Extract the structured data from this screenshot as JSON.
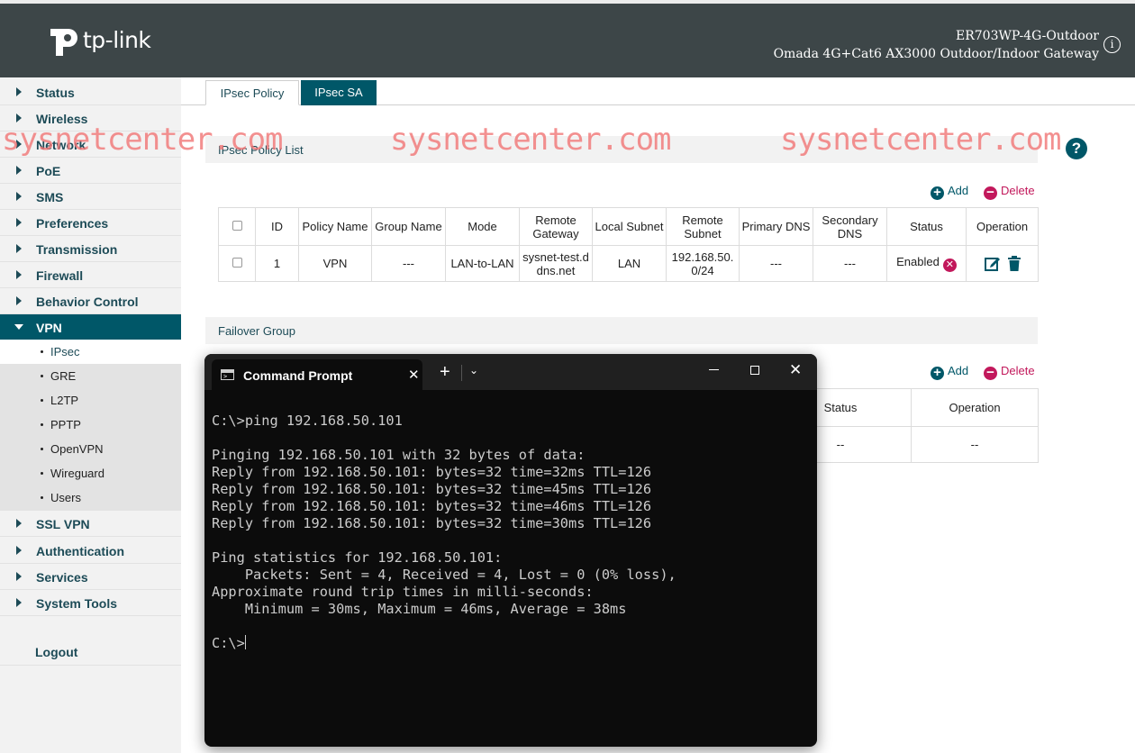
{
  "header": {
    "brand": "tp-link",
    "model_name": "ER703WP-4G-Outdoor",
    "model_desc": "Omada 4G+Cat6 AX3000 Outdoor/Indoor Gateway",
    "info_icon": "i"
  },
  "sidebar": {
    "items": [
      {
        "label": "Status"
      },
      {
        "label": "Wireless"
      },
      {
        "label": "Network"
      },
      {
        "label": "PoE"
      },
      {
        "label": "SMS"
      },
      {
        "label": "Preferences"
      },
      {
        "label": "Transmission"
      },
      {
        "label": "Firewall"
      },
      {
        "label": "Behavior Control"
      },
      {
        "label": "VPN"
      },
      {
        "label": "SSL VPN"
      },
      {
        "label": "Authentication"
      },
      {
        "label": "Services"
      },
      {
        "label": "System Tools"
      }
    ],
    "vpn_sub": [
      "IPsec",
      "GRE",
      "L2TP",
      "PPTP",
      "OpenVPN",
      "Wireguard",
      "Users"
    ],
    "logout": "Logout"
  },
  "tabs": [
    "IPsec Policy",
    "IPsec SA"
  ],
  "watermark": "sysnetcenter.com",
  "help_icon": "?",
  "policy": {
    "title": "IPsec Policy List",
    "add": "Add",
    "delete": "Delete",
    "headers": [
      "ID",
      "Policy Name",
      "Group Name",
      "Mode",
      "Remote Gateway",
      "Local Subnet",
      "Remote Subnet",
      "Primary DNS",
      "Secondary DNS",
      "Status",
      "Operation"
    ],
    "rows": [
      {
        "id": "1",
        "policy_name": "VPN",
        "group_name": "---",
        "mode": "LAN-to-LAN",
        "remote_gateway": "sysnet-test.ddns.net",
        "local_subnet": "LAN",
        "remote_subnet": "192.168.50.0/24",
        "primary_dns": "---",
        "secondary_dns": "---",
        "status": "Enabled"
      }
    ]
  },
  "failover": {
    "title": "Failover Group",
    "add": "Add",
    "delete": "Delete",
    "headers": [
      "Status",
      "Operation"
    ],
    "row": [
      "--",
      "--"
    ]
  },
  "cmd": {
    "title": "Command Prompt",
    "lines": [
      "C:\\>ping 192.168.50.101",
      "",
      "Pinging 192.168.50.101 with 32 bytes of data:",
      "Reply from 192.168.50.101: bytes=32 time=32ms TTL=126",
      "Reply from 192.168.50.101: bytes=32 time=45ms TTL=126",
      "Reply from 192.168.50.101: bytes=32 time=46ms TTL=126",
      "Reply from 192.168.50.101: bytes=32 time=30ms TTL=126",
      "",
      "Ping statistics for 192.168.50.101:",
      "    Packets: Sent = 4, Received = 4, Lost = 0 (0% loss),",
      "Approximate round trip times in milli-seconds:",
      "    Minimum = 30ms, Maximum = 46ms, Average = 38ms",
      "",
      "C:\\>"
    ]
  }
}
